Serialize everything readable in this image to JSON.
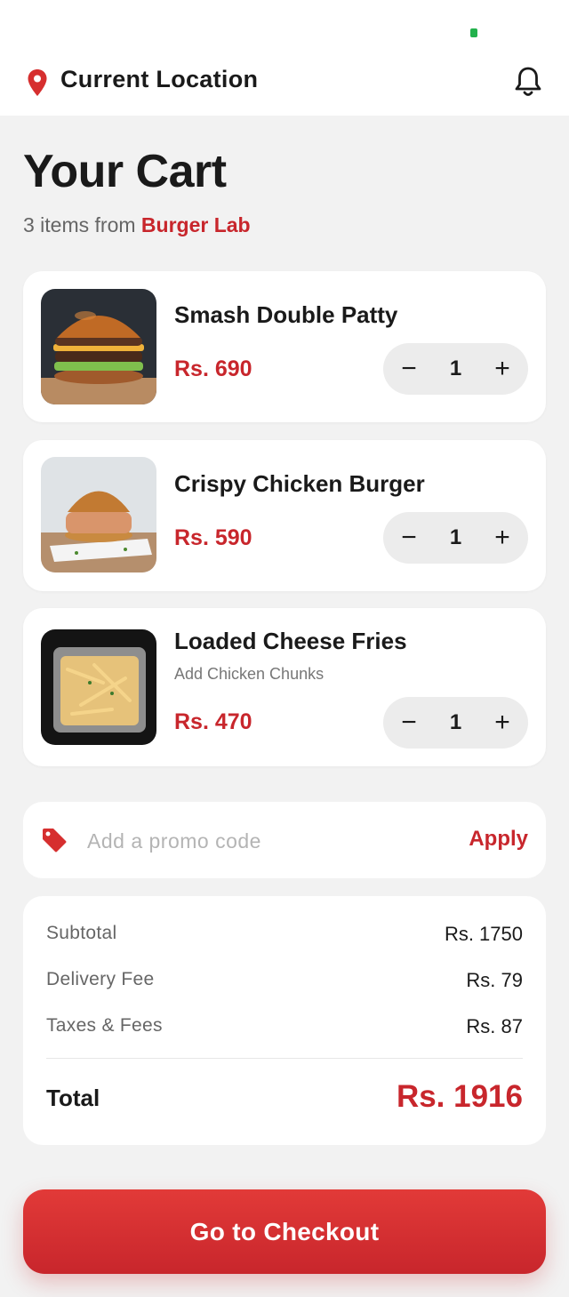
{
  "header": {
    "location_title": "Current Location",
    "icons": [
      "location-pin-icon",
      "bell-icon"
    ]
  },
  "page": {
    "title": "Your Cart",
    "subtitle_prefix": "3 items from",
    "restaurant": "Burger Lab"
  },
  "items": [
    {
      "name": "Smash Double Patty",
      "addon": "",
      "price": "Rs. 690",
      "qty": "1"
    },
    {
      "name": "Crispy Chicken Burger",
      "addon": "",
      "price": "Rs. 590",
      "qty": "1"
    },
    {
      "name": "Loaded Cheese Fries",
      "addon": "Add Chicken Chunks",
      "price": "Rs. 470",
      "qty": "1"
    }
  ],
  "stepper": {
    "minus": "−",
    "plus": "+"
  },
  "promo": {
    "placeholder": "Add a promo code",
    "apply_label": "Apply"
  },
  "summary": {
    "subtotal_label": "Subtotal",
    "subtotal_value": "Rs. 1750",
    "delivery_label": "Delivery Fee",
    "delivery_value": "Rs. 79",
    "taxes_label": "Taxes & Fees",
    "taxes_value": "Rs. 87",
    "total_label": "Total",
    "total_value": "Rs. 1916"
  },
  "checkout": {
    "label": "Go to Checkout"
  },
  "colors": {
    "accent": "#c8262c",
    "background": "#f2f2f2",
    "card": "#ffffff"
  }
}
